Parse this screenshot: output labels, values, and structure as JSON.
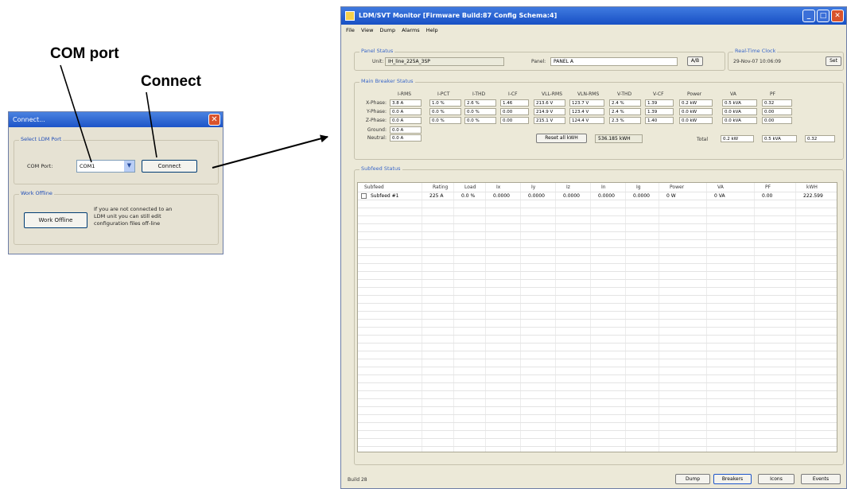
{
  "callouts": {
    "com_port": "COM port",
    "connect": "Connect"
  },
  "dialog": {
    "title": "Connect...",
    "select_group": "Select LDM Port",
    "com_port_label": "COM Port:",
    "com_port_value": "COM1",
    "connect_button": "Connect",
    "offline_group": "Work Offline",
    "offline_button": "Work Offline",
    "offline_text": [
      "If you are not connected to an",
      "LDM unit you can still edit",
      "configuration files off-line"
    ]
  },
  "monitor": {
    "title": "LDM/SVT Monitor [Firmware Build:87 Config Schema:4]",
    "menu": [
      "File",
      "View",
      "Dump",
      "Alarms",
      "Help"
    ],
    "panel_status": {
      "legend": "Panel Status",
      "unit_label": "Unit:",
      "unit_value": "IH_line_225A_3SP",
      "panel_label": "Panel:",
      "panel_value": "PANEL A",
      "button": "A/B"
    },
    "clock": {
      "legend": "Real-Time Clock",
      "value": "29-Nov-07 10:06:09",
      "button": "Set"
    },
    "main_breaker": {
      "legend": "Main Breaker Status",
      "headers": [
        "I-RMS",
        "I-PCT",
        "I-THD",
        "I-CF",
        "VLL-RMS",
        "VLN-RMS",
        "V-THD",
        "V-CF",
        "Power",
        "VA",
        "PF"
      ],
      "rows": [
        {
          "label": "X-Phase:",
          "values": [
            "3.8 A",
            "1.0 %",
            "2.6 %",
            "1.46",
            "213.6 V",
            "123.7 V",
            "2.4 %",
            "1.39",
            "0.2 kW",
            "0.5 kVA",
            "0.32"
          ]
        },
        {
          "label": "Y-Phase:",
          "values": [
            "0.0 A",
            "0.0 %",
            "0.0 %",
            "0.00",
            "214.9 V",
            "123.4 V",
            "2.4 %",
            "1.39",
            "0.0 kW",
            "0.0 kVA",
            "0.00"
          ]
        },
        {
          "label": "Z-Phase:",
          "values": [
            "0.0 A",
            "0.0 %",
            "0.0 %",
            "0.00",
            "215.1 V",
            "124.4 V",
            "2.3 %",
            "1.40",
            "0.0 kW",
            "0.0 kVA",
            "0.00"
          ]
        }
      ],
      "ground_label": "Ground:",
      "ground_value": "0.0 A",
      "neutral_label": "Neutral:",
      "neutral_value": "0.0 A",
      "reset_button": "Reset all kWH",
      "kwh_value": "536.185 kWH",
      "total_label": "Total",
      "total_values": [
        "0.2 kW",
        "0.5 kVA",
        "0.32"
      ]
    },
    "subfeed": {
      "legend": "Subfeed Status",
      "headers": [
        "Subfeed",
        "Rating",
        "Load",
        "Ix",
        "Iy",
        "Iz",
        "In",
        "Ig",
        "Power",
        "VA",
        "PF",
        "kWH"
      ],
      "rows": [
        [
          "Subfeed #1",
          "225 A",
          "0.0 %",
          "0.0000",
          "0.0000",
          "0.0000",
          "0.0000",
          "0.0000",
          "0 W",
          "0 VA",
          "0.00",
          "222.599"
        ]
      ]
    },
    "status_text": "Build 28",
    "tabs": [
      "Dump",
      "Breakers",
      "Icons",
      "Events"
    ]
  },
  "colors": {
    "titlebar": "#1d54c8",
    "dialog_bg": "#e6e2d3",
    "window_bg": "#ece9d8",
    "legend_blue": "#3a67c9",
    "close_red": "#d9532c"
  }
}
